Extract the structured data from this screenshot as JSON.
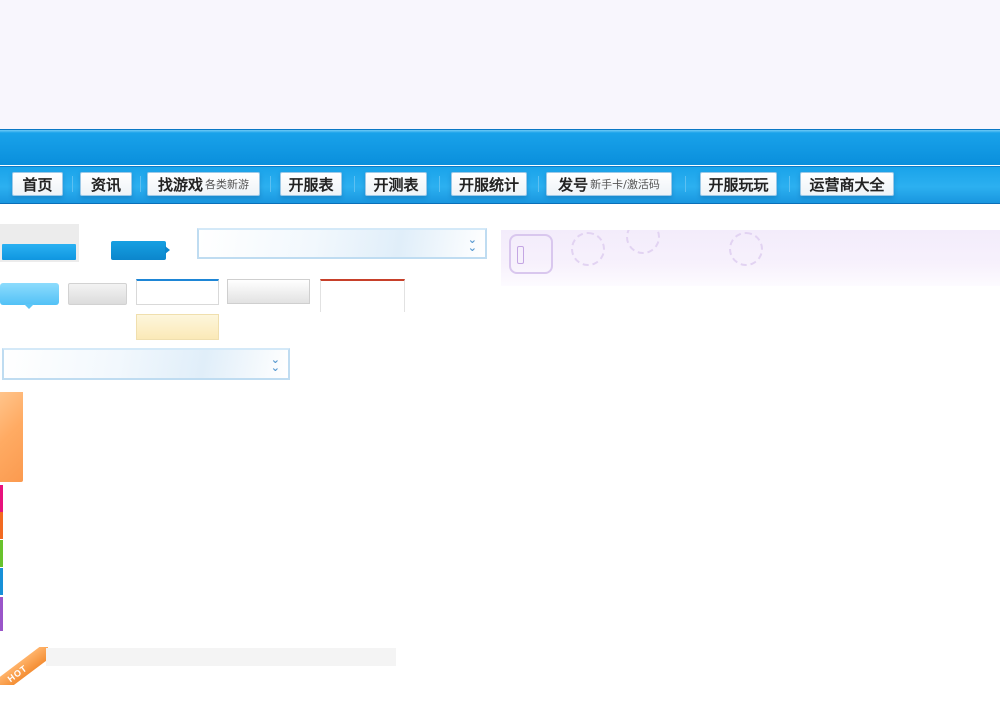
{
  "nav": {
    "items": [
      {
        "label": "首页",
        "sub": ""
      },
      {
        "label": "资讯",
        "sub": ""
      },
      {
        "label": "找游戏",
        "sub": "各类新游"
      },
      {
        "label": "开服表",
        "sub": ""
      },
      {
        "label": "开测表",
        "sub": ""
      },
      {
        "label": "开服统计",
        "sub": ""
      },
      {
        "label": "发号",
        "sub": "新手卡/激活码"
      },
      {
        "label": "开服玩玩",
        "sub": ""
      },
      {
        "label": "运营商大全",
        "sub": ""
      }
    ]
  },
  "sprites": {
    "select_chevron": "double-chevron-down-icon",
    "ribbon": {
      "label": "HOT"
    }
  },
  "colors": {
    "nav_band": "#1aa3ea",
    "tab_blue": "#0f96e0",
    "accent_red": "#c7402a",
    "orange": "#ffab63",
    "hot": "#f48e34",
    "bars": [
      "#e8127c",
      "#f26a21",
      "#68c22c",
      "#1790d8",
      "#9a55c9"
    ]
  }
}
